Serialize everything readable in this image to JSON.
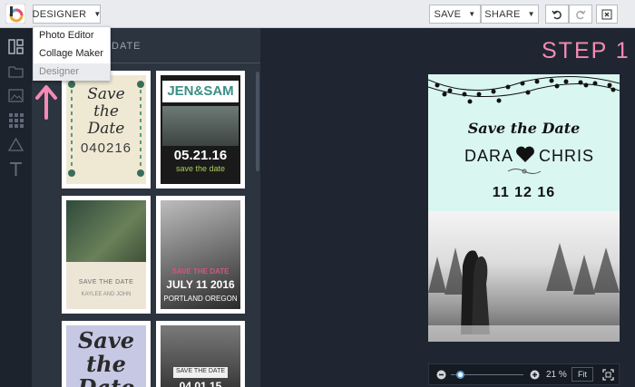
{
  "topbar": {
    "mode_label": "DESIGNER",
    "save_label": "SAVE",
    "share_label": "SHARE"
  },
  "dropdown": {
    "items": [
      "Photo Editor",
      "Collage Maker",
      "Designer"
    ],
    "selected": "Designer"
  },
  "panel": {
    "title": "DATE"
  },
  "canvas": {
    "step_label": "STEP 1"
  },
  "card": {
    "headline": "Save the Date",
    "name_left": "DARA",
    "name_right": "CHRIS",
    "date": "11 12 16"
  },
  "thumbs": [
    {
      "title": "Save the Date",
      "date": "040216"
    },
    {
      "names": "JEN&SAM",
      "date": "05.21.16",
      "sub": "save the date"
    },
    {
      "text": "SAVE THE DATE",
      "sub": "KAYLEE AND JOHN"
    },
    {
      "text": "SAVE THE DATE",
      "date": "JULY 11 2016",
      "place": "PORTLAND OREGON"
    },
    {
      "title": "Save the Date"
    },
    {
      "text": "SAVE THE DATE",
      "date": "04 01 15"
    }
  ],
  "zoom": {
    "value": "21 %",
    "fit_label": "Fit",
    "level": 0.12
  },
  "accent": "#f48bb4",
  "icons": [
    "templates-icon",
    "folder-icon",
    "image-icon",
    "grid-icon",
    "triangle-icon",
    "text-icon"
  ]
}
